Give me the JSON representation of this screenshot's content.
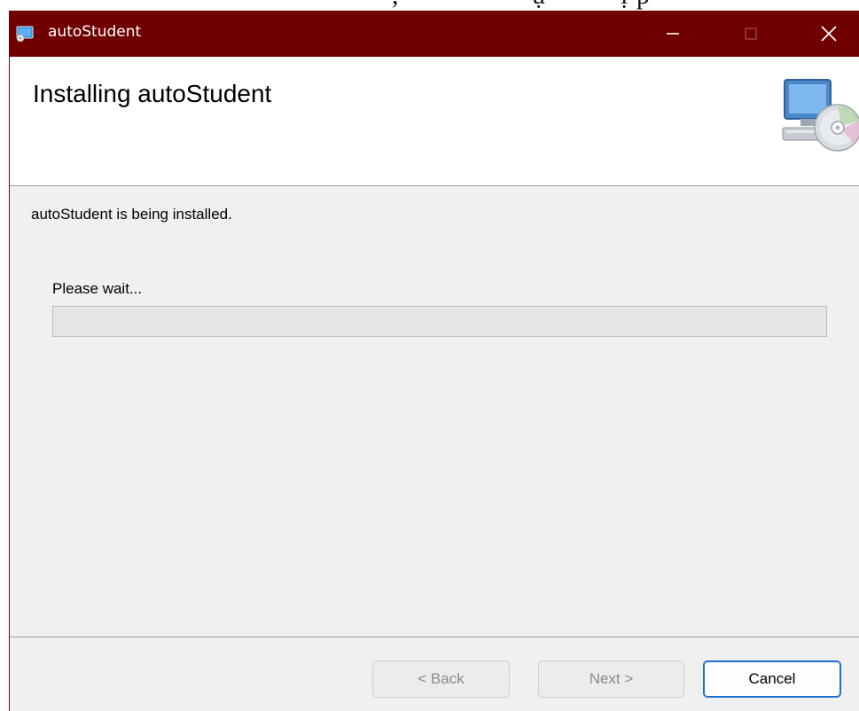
{
  "background": {
    "fragment_1": ",",
    "fragment_2": "ụ",
    "fragment_3": "ị p"
  },
  "window": {
    "title": "autoStudent",
    "minimize_glyph": "—",
    "maximize_glyph": "☐",
    "close_glyph": "✕"
  },
  "header": {
    "title": "Installing autoStudent",
    "icon": "computer-cd-icon"
  },
  "content": {
    "status_text": "autoStudent is being installed.",
    "wait_text": "Please wait...",
    "progress_percent": 0
  },
  "buttons": {
    "back_label": "< Back",
    "next_label": "Next >",
    "cancel_label": "Cancel"
  },
  "colors": {
    "titlebar": "#700000",
    "dialog_bg": "#f0f0f0",
    "accent": "#1f6fd1"
  }
}
